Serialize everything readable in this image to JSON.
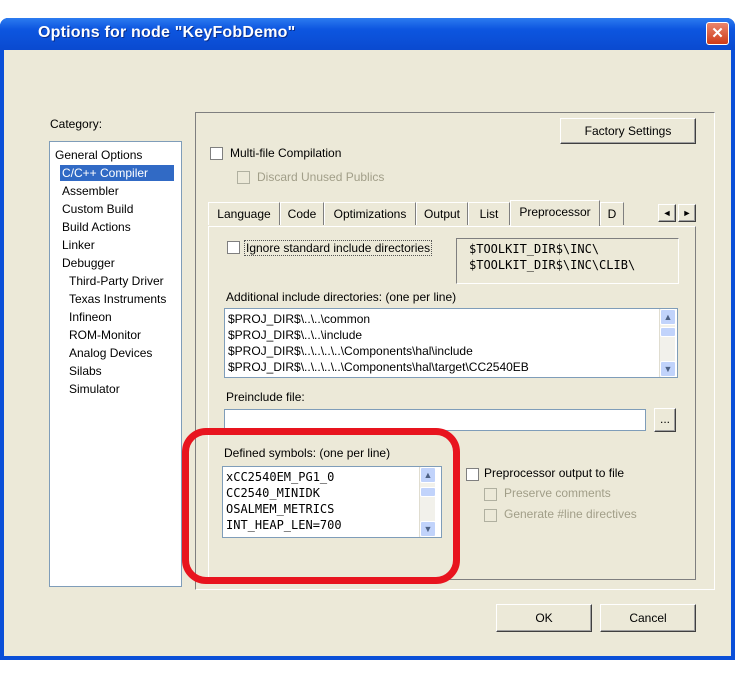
{
  "window": {
    "title": "Options for node \"KeyFobDemo\"",
    "close_symbol": "✕"
  },
  "category": {
    "label": "Category:",
    "items": [
      {
        "label": "General Options",
        "selected": false
      },
      {
        "label": "C/C++ Compiler",
        "selected": true
      },
      {
        "label": "Assembler",
        "selected": false
      },
      {
        "label": "Custom Build",
        "selected": false
      },
      {
        "label": "Build Actions",
        "selected": false
      },
      {
        "label": "Linker",
        "selected": false
      },
      {
        "label": "Debugger",
        "selected": false
      },
      {
        "label": "Third-Party Driver",
        "selected": false
      },
      {
        "label": "Texas Instruments",
        "selected": false
      },
      {
        "label": "Infineon",
        "selected": false
      },
      {
        "label": "ROM-Monitor",
        "selected": false
      },
      {
        "label": "Analog Devices",
        "selected": false
      },
      {
        "label": "Silabs",
        "selected": false
      },
      {
        "label": "Simulator",
        "selected": false
      }
    ]
  },
  "factory_settings_label": "Factory Settings",
  "multifile": {
    "label": "Multi-file Compilation",
    "checked": false,
    "discard_label": "Discard Unused Publics"
  },
  "tabs": [
    "Language",
    "Code",
    "Optimizations",
    "Output",
    "List",
    "Preprocessor",
    "D"
  ],
  "active_tab": "Preprocessor",
  "tab_scroll": {
    "left": "◄",
    "right": "►"
  },
  "preprocessor": {
    "ignore_std_label": "Ignore standard include directories",
    "std_dirs": [
      "$TOOLKIT_DIR$\\INC\\",
      "$TOOLKIT_DIR$\\INC\\CLIB\\"
    ],
    "additional_label": "Additional include directories: (one per line)",
    "include_dirs": [
      "$PROJ_DIR$\\..\\..\\common",
      "$PROJ_DIR$\\..\\..\\include",
      "$PROJ_DIR$\\..\\..\\..\\..\\Components\\hal\\include",
      "$PROJ_DIR$\\..\\..\\..\\..\\Components\\hal\\target\\CC2540EB"
    ],
    "preinclude_label": "Preinclude file:",
    "preinclude_value": "",
    "browse_label": "...",
    "defined_label": "Defined symbols: (one per line)",
    "symbols": [
      "xCC2540EM_PG1_0",
      "CC2540_MINIDK",
      "OSALMEM_METRICS",
      "INT_HEAP_LEN=700"
    ],
    "pp_output_label": "Preprocessor output to file",
    "preserve_label": "Preserve comments",
    "generate_label": "Generate #line directives"
  },
  "buttons": {
    "ok": "OK",
    "cancel": "Cancel"
  },
  "highlight_color": "#e8141e"
}
